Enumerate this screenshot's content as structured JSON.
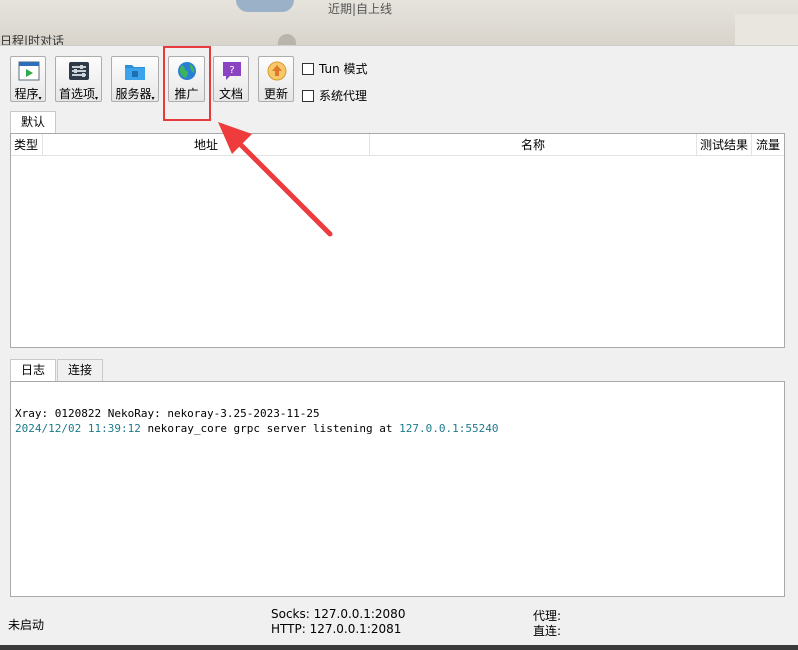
{
  "background": {
    "left_text": "日程|时对话",
    "right_text": "近期|自上线"
  },
  "toolbar": {
    "program_label": "程序",
    "preferences_label": "首选项",
    "servers_label": "服务器",
    "promote_label": "推广",
    "docs_label": "文档",
    "update_label": "更新",
    "tun_mode_label": "Tun 模式",
    "system_proxy_label": "系统代理",
    "dropdown_caret": "▾"
  },
  "group_tabs": [
    "默认"
  ],
  "server_table": {
    "columns": [
      "类型",
      "地址",
      "名称",
      "测试结果",
      "流量"
    ],
    "rows": []
  },
  "log_tabs": [
    "日志",
    "连接"
  ],
  "log": {
    "line1": "Xray: 0120822 NekoRay: nekoray-3.25-2023-11-25",
    "line2_timestamp": "2024/12/02 11:39:12",
    "line2_message": " nekoray_core grpc server listening at ",
    "line2_address": "127.0.0.1:55240"
  },
  "status": {
    "state": "未启动",
    "socks": "Socks: 127.0.0.1:2080",
    "http": "HTTP: 127.0.0.1:2081",
    "proxy": "代理:",
    "direct": "直连:"
  },
  "colors": {
    "highlight": "#e83a3a",
    "log_teal": "#1d7a8a"
  },
  "icons": {
    "program": "program-window-icon",
    "preferences": "settings-sliders-icon",
    "servers": "server-folder-icon",
    "promote": "globe-icon",
    "docs": "help-book-icon",
    "update": "update-arrow-icon"
  }
}
